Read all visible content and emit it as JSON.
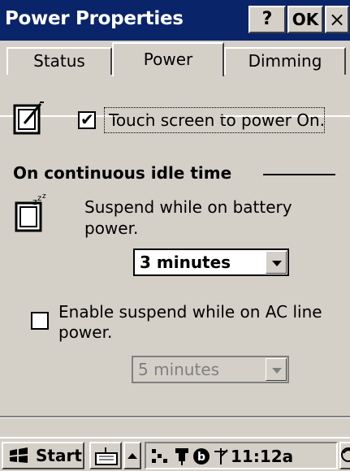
{
  "window": {
    "title": "Power Properties",
    "help_label": "?",
    "ok_label": "OK",
    "close_label": "×"
  },
  "tabs": [
    {
      "label": "Status",
      "active": false
    },
    {
      "label": "Power",
      "active": true
    },
    {
      "label": "Dimming",
      "active": false
    }
  ],
  "touch": {
    "checkbox_checked": true,
    "label": "Touch screen to power On."
  },
  "idle": {
    "section_title": "On continuous idle time",
    "battery_label_line1": "Suspend while on battery",
    "battery_label_line2": "power.",
    "battery_value": "3 minutes",
    "ac_checkbox_checked": false,
    "ac_label_line1": "Enable suspend while on AC line",
    "ac_label_line2": "power.",
    "ac_value": "5 minutes"
  },
  "taskbar": {
    "start_label": "Start",
    "clock": "11:12a"
  },
  "colors": {
    "titlebar": "#0a246a",
    "face": "#d4d0c8",
    "disabled_text": "#808080"
  }
}
